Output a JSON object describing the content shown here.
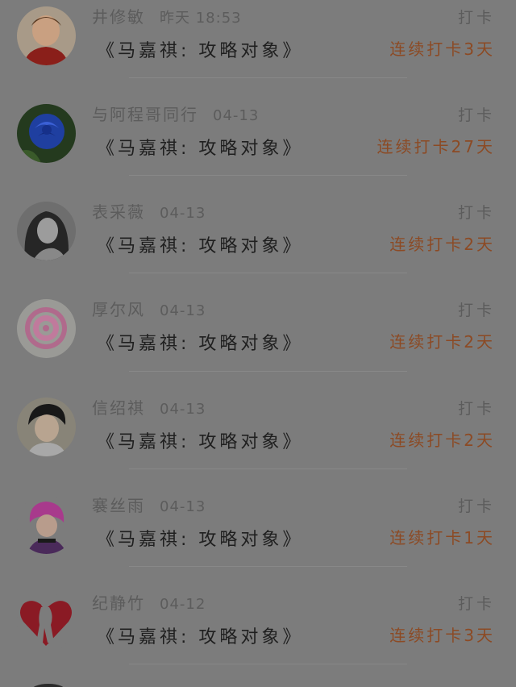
{
  "checkin_feed": {
    "items": [
      {
        "user": "井修敏",
        "time": "昨天 18:53",
        "label": "打卡",
        "title": "《马嘉祺: 攻略对象》",
        "streak": "连续打卡3天",
        "avatar_icon": "child-photo-icon"
      },
      {
        "user": "与阿程哥同行",
        "time": "04-13",
        "label": "打卡",
        "title": "《马嘉祺: 攻略对象》",
        "streak": "连续打卡27天",
        "avatar_icon": "blue-rose-icon"
      },
      {
        "user": "表采薇",
        "time": "04-13",
        "label": "打卡",
        "title": "《马嘉祺: 攻略对象》",
        "streak": "连续打卡2天",
        "avatar_icon": "woman-photo-icon"
      },
      {
        "user": "厚尔风",
        "time": "04-13",
        "label": "打卡",
        "title": "《马嘉祺: 攻略对象》",
        "streak": "连续打卡2天",
        "avatar_icon": "flower-pattern-icon"
      },
      {
        "user": "信绍祺",
        "time": "04-13",
        "label": "打卡",
        "title": "《马嘉祺: 攻略对象》",
        "streak": "连续打卡2天",
        "avatar_icon": "man-photo-icon"
      },
      {
        "user": "褰丝雨",
        "time": "04-13",
        "label": "打卡",
        "title": "《马嘉祺: 攻略对象》",
        "streak": "连续打卡1天",
        "avatar_icon": "anime-character-icon"
      },
      {
        "user": "纪静竹",
        "time": "04-12",
        "label": "打卡",
        "title": "《马嘉祺: 攻略对象》",
        "streak": "连续打卡3天",
        "avatar_icon": "red-heart-couple-icon"
      }
    ]
  },
  "colors": {
    "overlay_background": "#7c7c7c",
    "streak_accent": "#8c4a24",
    "meta_text": "#5c5c5c",
    "title_text": "#1f1f1f"
  }
}
